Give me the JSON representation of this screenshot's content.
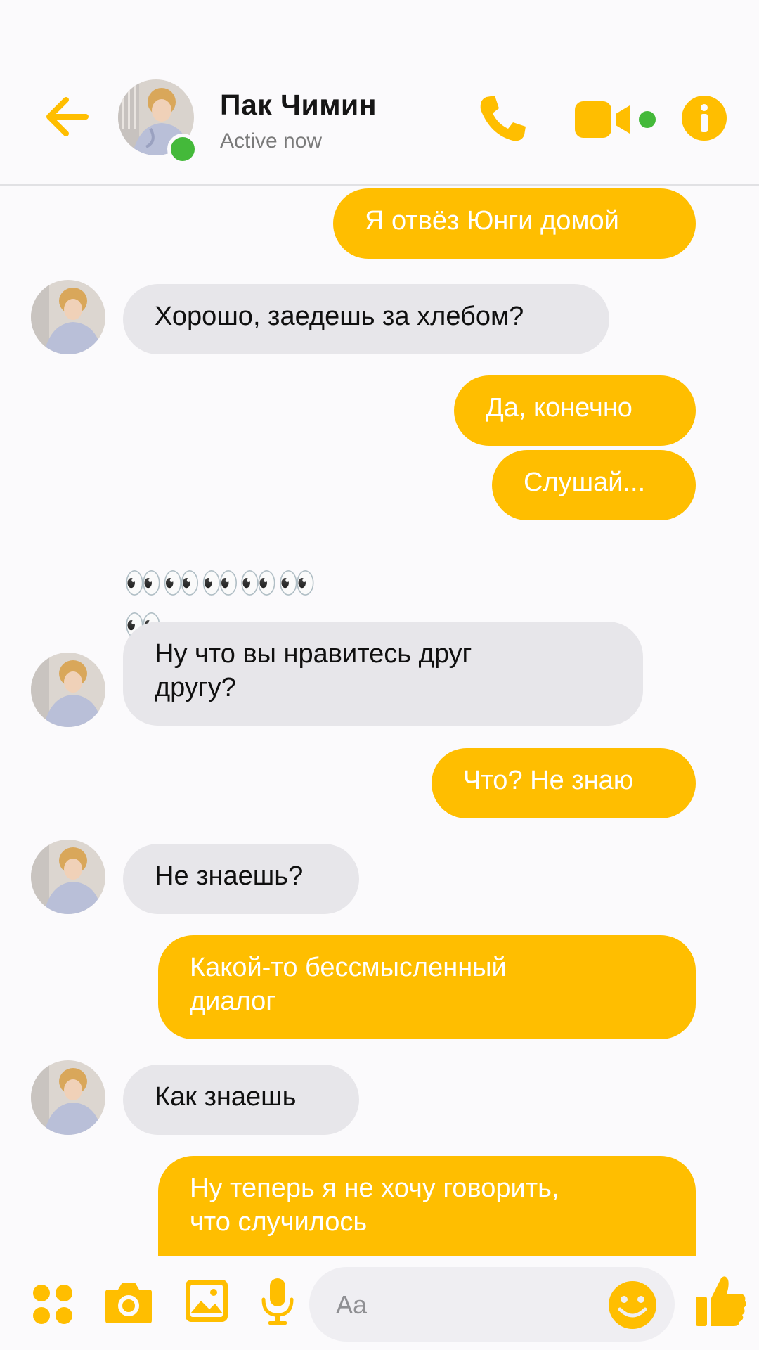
{
  "header": {
    "contact_name": "Пак Чимин",
    "status": "Active now"
  },
  "icons": {
    "back": "back-arrow-icon",
    "phone": "phone-icon",
    "video": "video-camera-icon",
    "info": "info-icon",
    "apps": "apps-grid-icon",
    "camera": "camera-icon",
    "gallery": "image-icon",
    "mic": "microphone-icon",
    "emoji": "smiley-icon",
    "like": "thumbs-up-icon"
  },
  "colors": {
    "accent": "#ffbe00",
    "incoming_bubble": "#e7e6ea",
    "online": "#44b93a"
  },
  "messages": [
    {
      "dir": "out",
      "text": "Я отвёз Юнги домой"
    },
    {
      "dir": "in",
      "text": "Хорошо, заедешь за хлебом?"
    },
    {
      "dir": "out",
      "text": "Да, конечно"
    },
    {
      "dir": "out",
      "text": "Слушай..."
    },
    {
      "dir": "in",
      "text": "👀👀👀👀👀👀"
    },
    {
      "dir": "in",
      "text": "Ну что вы нравитесь друг другу?"
    },
    {
      "dir": "out",
      "text": "Что? Не знаю"
    },
    {
      "dir": "in",
      "text": "Не знаешь?"
    },
    {
      "dir": "out",
      "text": "Какой-то бессмысленный диалог"
    },
    {
      "dir": "in",
      "text": "Как знаешь"
    },
    {
      "dir": "out",
      "text": "Ну теперь я не хочу говорить, что случилось"
    }
  ],
  "composer": {
    "placeholder": "Aa"
  }
}
